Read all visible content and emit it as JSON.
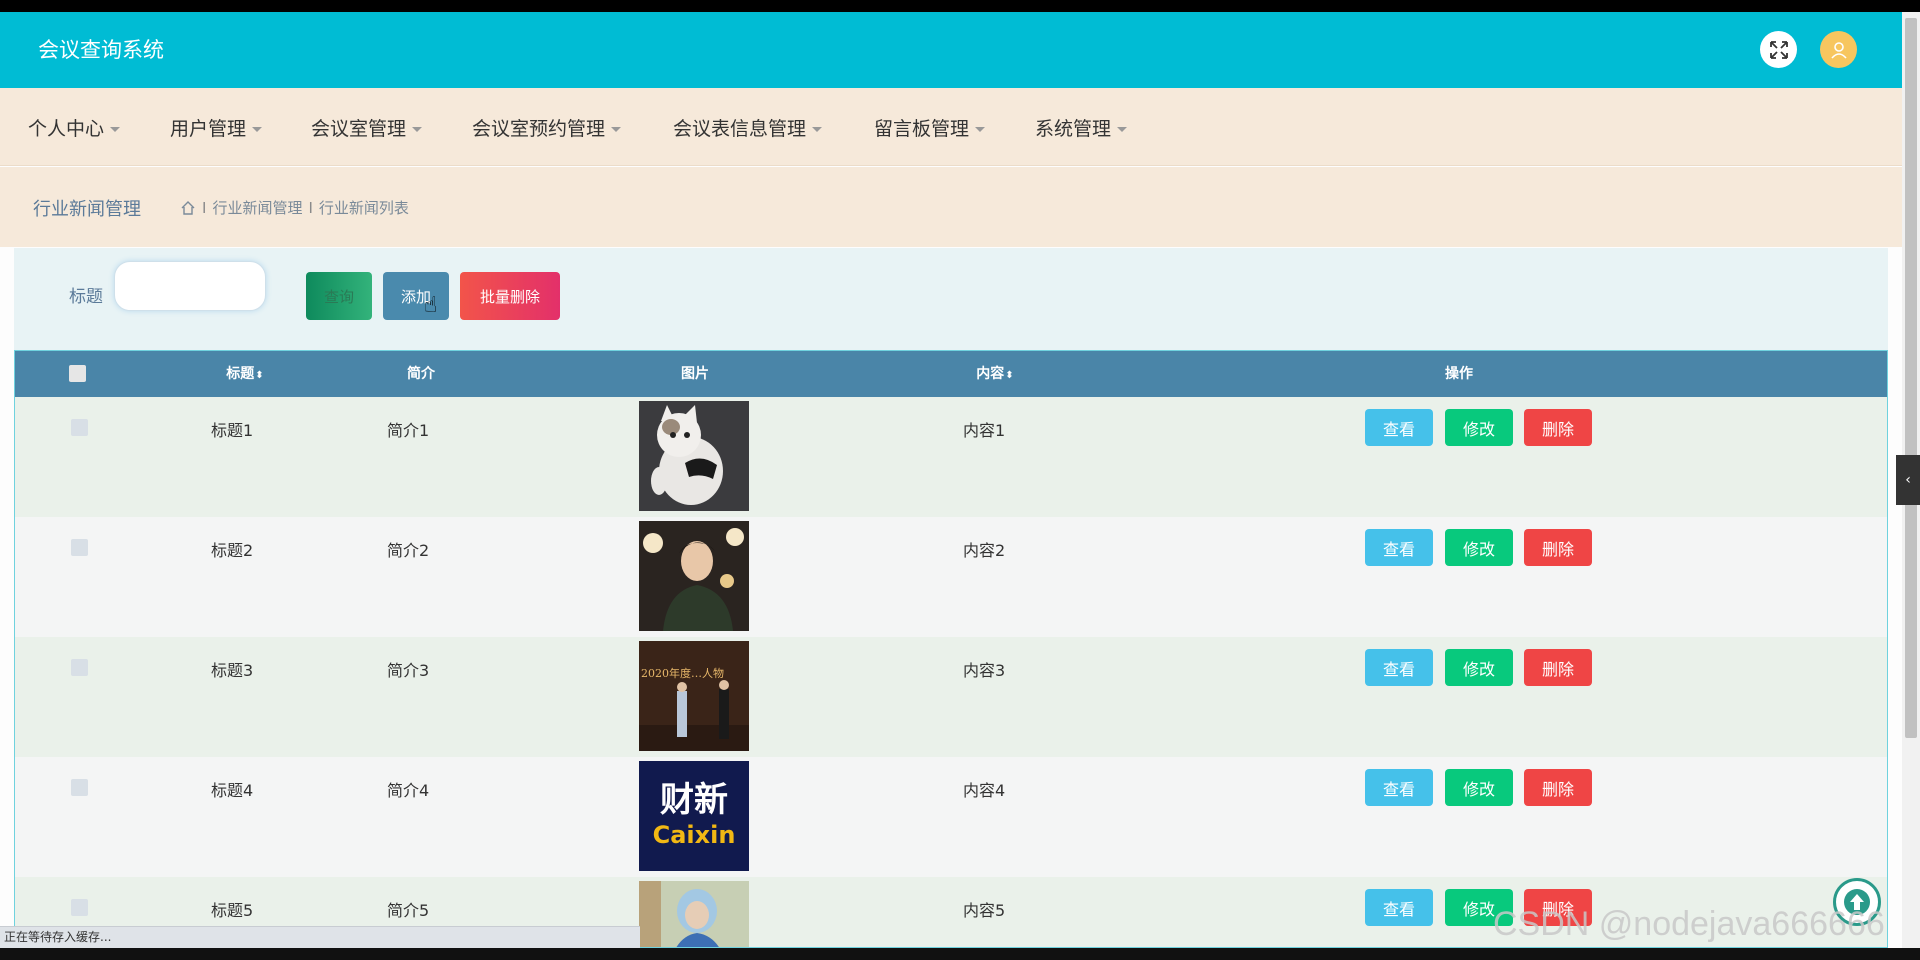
{
  "app": {
    "title": "会议查询系统"
  },
  "header": {
    "fullscreen_icon": "expand-icon",
    "user_icon": "user-icon"
  },
  "nav": [
    {
      "label": "个人中心"
    },
    {
      "label": "用户管理"
    },
    {
      "label": "会议室管理"
    },
    {
      "label": "会议室预约管理"
    },
    {
      "label": "会议表信息管理"
    },
    {
      "label": "留言板管理"
    },
    {
      "label": "系统管理"
    }
  ],
  "breadcrumb": {
    "title": "行业新闻管理",
    "items": [
      "行业新闻管理",
      "行业新闻列表"
    ],
    "separator": "I"
  },
  "search": {
    "label": "标题",
    "value": "",
    "search_label": "查询",
    "add_label": "添加",
    "batch_delete_label": "批量删除"
  },
  "table": {
    "columns": [
      "标题",
      "简介",
      "图片",
      "内容",
      "操作"
    ],
    "sort_icon": "⬍",
    "rows": [
      {
        "title": "标题1",
        "intro": "简介1",
        "content": "内容1",
        "image": "cat-photo"
      },
      {
        "title": "标题2",
        "intro": "简介2",
        "content": "内容2",
        "image": "person-portrait-photo"
      },
      {
        "title": "标题3",
        "intro": "简介3",
        "content": "内容3",
        "image": "event-stage-photo"
      },
      {
        "title": "标题4",
        "intro": "简介4",
        "content": "内容4",
        "image": "caixin-logo"
      },
      {
        "title": "标题5",
        "intro": "简介5",
        "content": "内容5",
        "image": "medical-worker-photo"
      }
    ],
    "actions": {
      "view": "查看",
      "edit": "修改",
      "delete": "删除"
    }
  },
  "status_bar": {
    "text": "正在等待存入缓存..."
  },
  "watermark": {
    "text": "CSDN @nodejava666666"
  },
  "image_text": {
    "caixin_cn": "财新",
    "caixin_en": "Caixin",
    "stage_banner": "2020年度…人物"
  },
  "colors": {
    "topbar": "#00bcd4",
    "nav_bg": "#f6e9da",
    "table_header": "#4a85a8",
    "view_btn": "#45c1ea",
    "edit_btn": "#08c97d",
    "delete_btn": "#ef4545"
  }
}
